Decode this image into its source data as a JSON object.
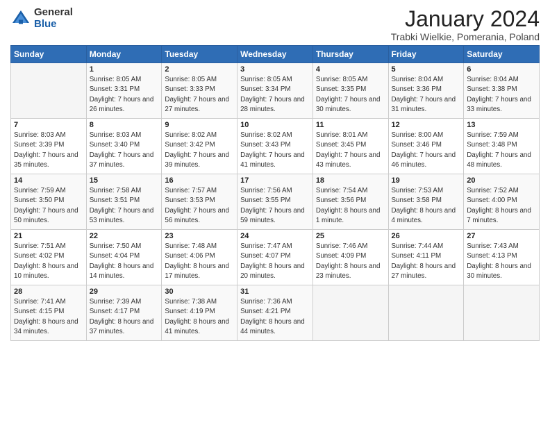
{
  "header": {
    "logo_general": "General",
    "logo_blue": "Blue",
    "title": "January 2024",
    "location": "Trabki Wielkie, Pomerania, Poland"
  },
  "days_of_week": [
    "Sunday",
    "Monday",
    "Tuesday",
    "Wednesday",
    "Thursday",
    "Friday",
    "Saturday"
  ],
  "weeks": [
    [
      {
        "day": "",
        "sunrise": "",
        "sunset": "",
        "daylight": ""
      },
      {
        "day": "1",
        "sunrise": "Sunrise: 8:05 AM",
        "sunset": "Sunset: 3:31 PM",
        "daylight": "Daylight: 7 hours and 26 minutes."
      },
      {
        "day": "2",
        "sunrise": "Sunrise: 8:05 AM",
        "sunset": "Sunset: 3:33 PM",
        "daylight": "Daylight: 7 hours and 27 minutes."
      },
      {
        "day": "3",
        "sunrise": "Sunrise: 8:05 AM",
        "sunset": "Sunset: 3:34 PM",
        "daylight": "Daylight: 7 hours and 28 minutes."
      },
      {
        "day": "4",
        "sunrise": "Sunrise: 8:05 AM",
        "sunset": "Sunset: 3:35 PM",
        "daylight": "Daylight: 7 hours and 30 minutes."
      },
      {
        "day": "5",
        "sunrise": "Sunrise: 8:04 AM",
        "sunset": "Sunset: 3:36 PM",
        "daylight": "Daylight: 7 hours and 31 minutes."
      },
      {
        "day": "6",
        "sunrise": "Sunrise: 8:04 AM",
        "sunset": "Sunset: 3:38 PM",
        "daylight": "Daylight: 7 hours and 33 minutes."
      }
    ],
    [
      {
        "day": "7",
        "sunrise": "Sunrise: 8:03 AM",
        "sunset": "Sunset: 3:39 PM",
        "daylight": "Daylight: 7 hours and 35 minutes."
      },
      {
        "day": "8",
        "sunrise": "Sunrise: 8:03 AM",
        "sunset": "Sunset: 3:40 PM",
        "daylight": "Daylight: 7 hours and 37 minutes."
      },
      {
        "day": "9",
        "sunrise": "Sunrise: 8:02 AM",
        "sunset": "Sunset: 3:42 PM",
        "daylight": "Daylight: 7 hours and 39 minutes."
      },
      {
        "day": "10",
        "sunrise": "Sunrise: 8:02 AM",
        "sunset": "Sunset: 3:43 PM",
        "daylight": "Daylight: 7 hours and 41 minutes."
      },
      {
        "day": "11",
        "sunrise": "Sunrise: 8:01 AM",
        "sunset": "Sunset: 3:45 PM",
        "daylight": "Daylight: 7 hours and 43 minutes."
      },
      {
        "day": "12",
        "sunrise": "Sunrise: 8:00 AM",
        "sunset": "Sunset: 3:46 PM",
        "daylight": "Daylight: 7 hours and 46 minutes."
      },
      {
        "day": "13",
        "sunrise": "Sunrise: 7:59 AM",
        "sunset": "Sunset: 3:48 PM",
        "daylight": "Daylight: 7 hours and 48 minutes."
      }
    ],
    [
      {
        "day": "14",
        "sunrise": "Sunrise: 7:59 AM",
        "sunset": "Sunset: 3:50 PM",
        "daylight": "Daylight: 7 hours and 50 minutes."
      },
      {
        "day": "15",
        "sunrise": "Sunrise: 7:58 AM",
        "sunset": "Sunset: 3:51 PM",
        "daylight": "Daylight: 7 hours and 53 minutes."
      },
      {
        "day": "16",
        "sunrise": "Sunrise: 7:57 AM",
        "sunset": "Sunset: 3:53 PM",
        "daylight": "Daylight: 7 hours and 56 minutes."
      },
      {
        "day": "17",
        "sunrise": "Sunrise: 7:56 AM",
        "sunset": "Sunset: 3:55 PM",
        "daylight": "Daylight: 7 hours and 59 minutes."
      },
      {
        "day": "18",
        "sunrise": "Sunrise: 7:54 AM",
        "sunset": "Sunset: 3:56 PM",
        "daylight": "Daylight: 8 hours and 1 minute."
      },
      {
        "day": "19",
        "sunrise": "Sunrise: 7:53 AM",
        "sunset": "Sunset: 3:58 PM",
        "daylight": "Daylight: 8 hours and 4 minutes."
      },
      {
        "day": "20",
        "sunrise": "Sunrise: 7:52 AM",
        "sunset": "Sunset: 4:00 PM",
        "daylight": "Daylight: 8 hours and 7 minutes."
      }
    ],
    [
      {
        "day": "21",
        "sunrise": "Sunrise: 7:51 AM",
        "sunset": "Sunset: 4:02 PM",
        "daylight": "Daylight: 8 hours and 10 minutes."
      },
      {
        "day": "22",
        "sunrise": "Sunrise: 7:50 AM",
        "sunset": "Sunset: 4:04 PM",
        "daylight": "Daylight: 8 hours and 14 minutes."
      },
      {
        "day": "23",
        "sunrise": "Sunrise: 7:48 AM",
        "sunset": "Sunset: 4:06 PM",
        "daylight": "Daylight: 8 hours and 17 minutes."
      },
      {
        "day": "24",
        "sunrise": "Sunrise: 7:47 AM",
        "sunset": "Sunset: 4:07 PM",
        "daylight": "Daylight: 8 hours and 20 minutes."
      },
      {
        "day": "25",
        "sunrise": "Sunrise: 7:46 AM",
        "sunset": "Sunset: 4:09 PM",
        "daylight": "Daylight: 8 hours and 23 minutes."
      },
      {
        "day": "26",
        "sunrise": "Sunrise: 7:44 AM",
        "sunset": "Sunset: 4:11 PM",
        "daylight": "Daylight: 8 hours and 27 minutes."
      },
      {
        "day": "27",
        "sunrise": "Sunrise: 7:43 AM",
        "sunset": "Sunset: 4:13 PM",
        "daylight": "Daylight: 8 hours and 30 minutes."
      }
    ],
    [
      {
        "day": "28",
        "sunrise": "Sunrise: 7:41 AM",
        "sunset": "Sunset: 4:15 PM",
        "daylight": "Daylight: 8 hours and 34 minutes."
      },
      {
        "day": "29",
        "sunrise": "Sunrise: 7:39 AM",
        "sunset": "Sunset: 4:17 PM",
        "daylight": "Daylight: 8 hours and 37 minutes."
      },
      {
        "day": "30",
        "sunrise": "Sunrise: 7:38 AM",
        "sunset": "Sunset: 4:19 PM",
        "daylight": "Daylight: 8 hours and 41 minutes."
      },
      {
        "day": "31",
        "sunrise": "Sunrise: 7:36 AM",
        "sunset": "Sunset: 4:21 PM",
        "daylight": "Daylight: 8 hours and 44 minutes."
      },
      {
        "day": "",
        "sunrise": "",
        "sunset": "",
        "daylight": ""
      },
      {
        "day": "",
        "sunrise": "",
        "sunset": "",
        "daylight": ""
      },
      {
        "day": "",
        "sunrise": "",
        "sunset": "",
        "daylight": ""
      }
    ]
  ]
}
